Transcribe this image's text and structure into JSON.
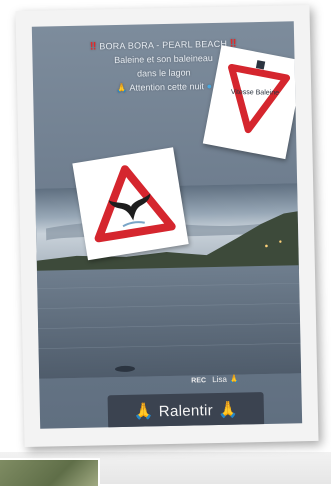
{
  "caption": {
    "line1": "BORA BORA - PEARL BEACH",
    "line2": "Baleine et son baleineau",
    "line3": "dans le lagon",
    "line4": "Attention cette nuit"
  },
  "sticker_sign_text": "Vitesse Baleine",
  "rec": {
    "rec_label": "REC",
    "name": "Lisa"
  },
  "ralentir_label": "Ralentir",
  "colors": {
    "sign_red": "#d5262e",
    "alert_red": "#e02a2a",
    "banner_bg": "#3b4350",
    "prayer_hands": "#f3b24a"
  },
  "icons": [
    "double-exclamation-icon",
    "whale-tail-warning-sign",
    "speed-warning-sign",
    "prayer-hands-icon",
    "globe-emoji-icon"
  ]
}
